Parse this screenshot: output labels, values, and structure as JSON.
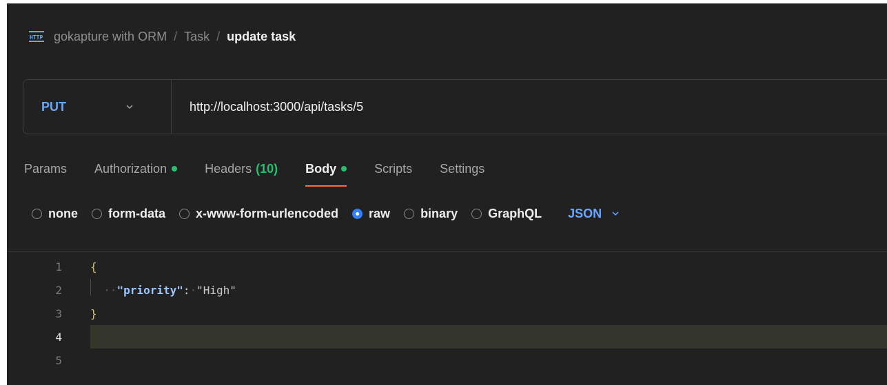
{
  "breadcrumb": {
    "icon": "http-icon",
    "collection": "gokapture with ORM",
    "folder": "Task",
    "request": "update task",
    "separator": "/"
  },
  "request": {
    "method": "PUT",
    "url": "http://localhost:3000/api/tasks/5"
  },
  "tabs": [
    {
      "label": "Params"
    },
    {
      "label": "Authorization",
      "dot": true
    },
    {
      "label": "Headers",
      "count": "(10)"
    },
    {
      "label": "Body",
      "dot": true,
      "active": true
    },
    {
      "label": "Scripts"
    },
    {
      "label": "Settings"
    }
  ],
  "body_types": [
    {
      "label": "none",
      "checked": false
    },
    {
      "label": "form-data",
      "checked": false
    },
    {
      "label": "x-www-form-urlencoded",
      "checked": false
    },
    {
      "label": "raw",
      "checked": true
    },
    {
      "label": "binary",
      "checked": false
    },
    {
      "label": "GraphQL",
      "checked": false
    }
  ],
  "language": "JSON",
  "editor": {
    "lines": [
      {
        "number": "1",
        "brace": "{"
      },
      {
        "number": "2",
        "key": "\"priority\"",
        "colon": ":",
        "value": "\"High\""
      },
      {
        "number": "3",
        "brace": "}"
      },
      {
        "number": "4",
        "current": true
      },
      {
        "number": "5"
      }
    ]
  },
  "colors": {
    "background": "#212121",
    "method": "#6aa7ff",
    "active_tab_underline": "#ff6c37",
    "status_dot": "#2dbd6e",
    "radio_checked": "#2f7fff"
  }
}
